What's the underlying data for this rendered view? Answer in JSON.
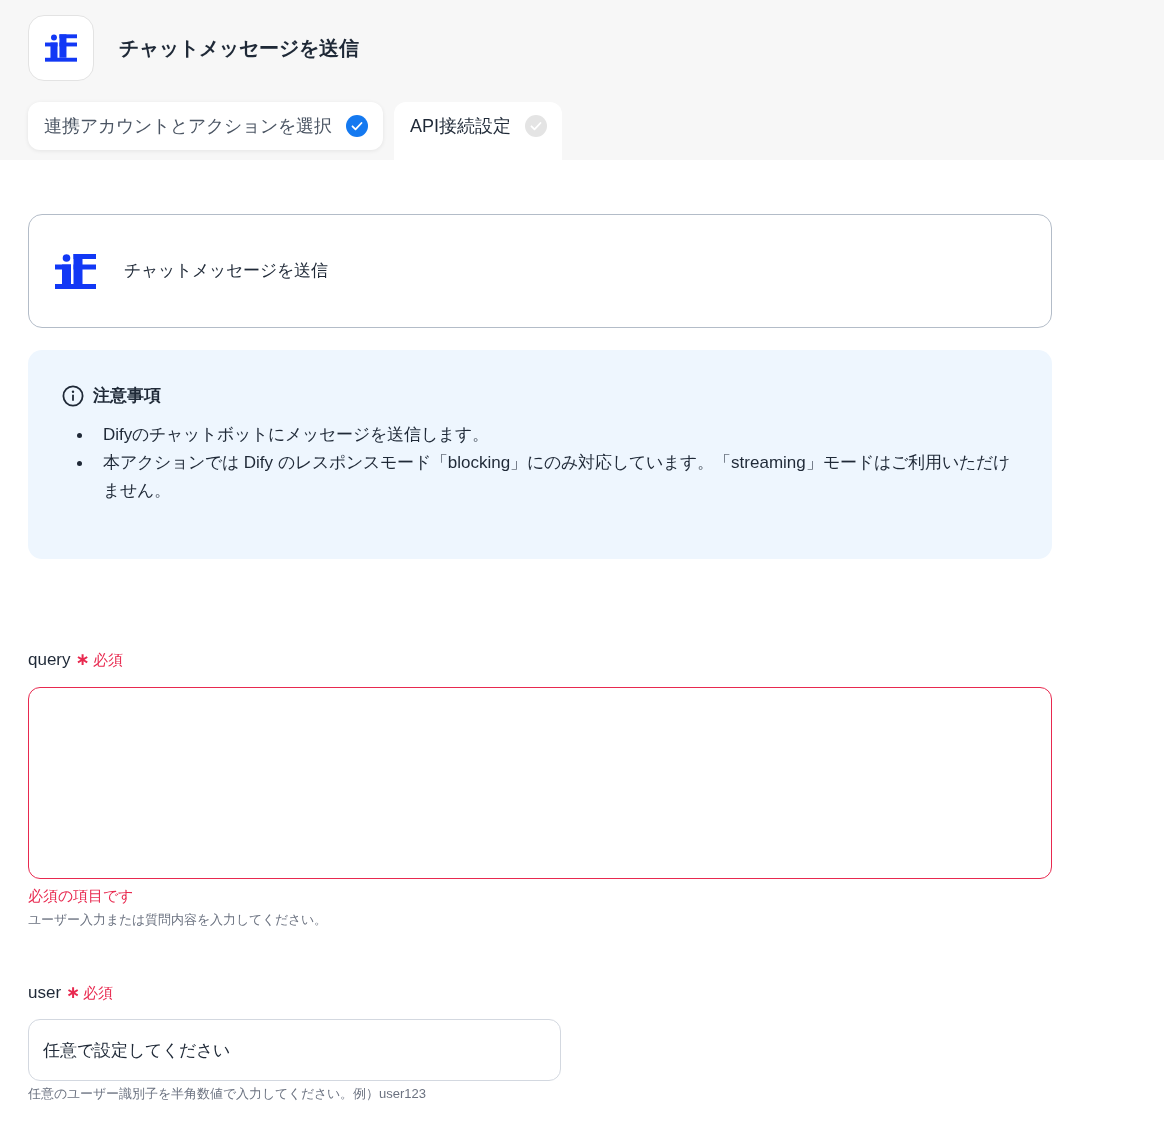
{
  "header": {
    "title": "チャットメッセージを送信"
  },
  "tabs": [
    {
      "label": "連携アカウントとアクションを選択",
      "selected": false,
      "completed": true
    },
    {
      "label": "API接続設定",
      "selected": true,
      "completed": false
    }
  ],
  "action_card": {
    "title": "チャットメッセージを送信"
  },
  "notice": {
    "title": "注意事項",
    "items": [
      "Difyのチャットボットにメッセージを送信します。",
      "本アクションでは Dify のレスポンスモード「blocking」にのみ対応しています。「streaming」モードはご利用いただけません。"
    ]
  },
  "fields": [
    {
      "kind": "textarea",
      "label": "query",
      "required": true,
      "required_mark": "∗",
      "required_label": "必須",
      "invalid": true,
      "error": "必須の項目です",
      "help": "ユーザー入力または質問内容を入力してください。"
    },
    {
      "kind": "text",
      "label": "user",
      "required": true,
      "required_mark": "∗",
      "required_label": "必須",
      "invalid": false,
      "value": "任意で設定してください",
      "help": "任意のユーザー識別子を半角数値で入力してください。例）user123"
    }
  ]
}
